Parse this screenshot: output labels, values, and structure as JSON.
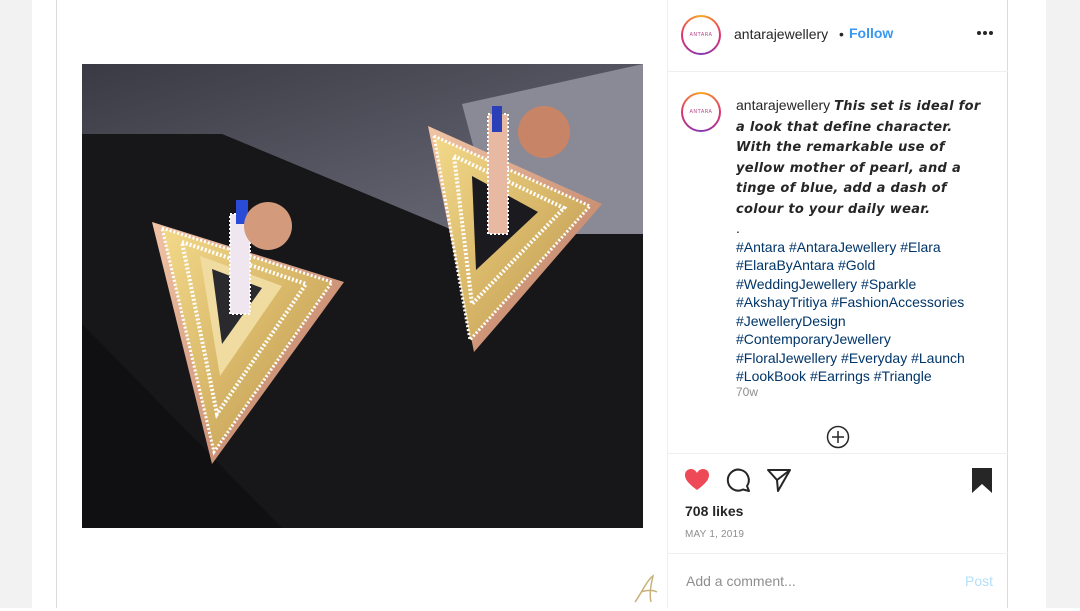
{
  "header": {
    "username": "antarajewellery",
    "separator": "•",
    "follow_label": "Follow",
    "avatar_text": "ANTARA"
  },
  "caption": {
    "username": "antarajewellery",
    "text": "This set is ideal for a look that define character. With the remarkable use of yellow mother of pearl, and a tinge of blue, add a dash of colour to your daily wear.",
    "dot": ".",
    "hashtags": [
      "#Antara",
      "#AntaraJewellery",
      "#Elara",
      "#ElaraByAntara",
      "#Gold",
      "#WeddingJewellery",
      "#Sparkle",
      "#AkshayTritiya",
      "#FashionAccessories",
      "#JewelleryDesign",
      "#ContemporaryJewellery",
      "#FloralJewellery",
      "#Everyday",
      "#Launch",
      "#LookBook",
      "#Earrings",
      "#Triangle"
    ],
    "time_ago": "70w"
  },
  "actions": {
    "liked": true,
    "saved": true
  },
  "stats": {
    "likes": "708 likes",
    "date": "MAY 1, 2019"
  },
  "comment": {
    "placeholder": "Add a comment...",
    "post_label": "Post"
  },
  "colors": {
    "accent": "#3897f0",
    "like": "#ed4956",
    "post_disabled": "#b2dffc",
    "hashtag": "#003569",
    "muted": "#8e8e8e"
  },
  "icons": [
    "more-options-icon",
    "load-more-comments-icon",
    "heart-icon",
    "comment-icon",
    "share-icon",
    "bookmark-icon",
    "signature-watermark-icon"
  ]
}
